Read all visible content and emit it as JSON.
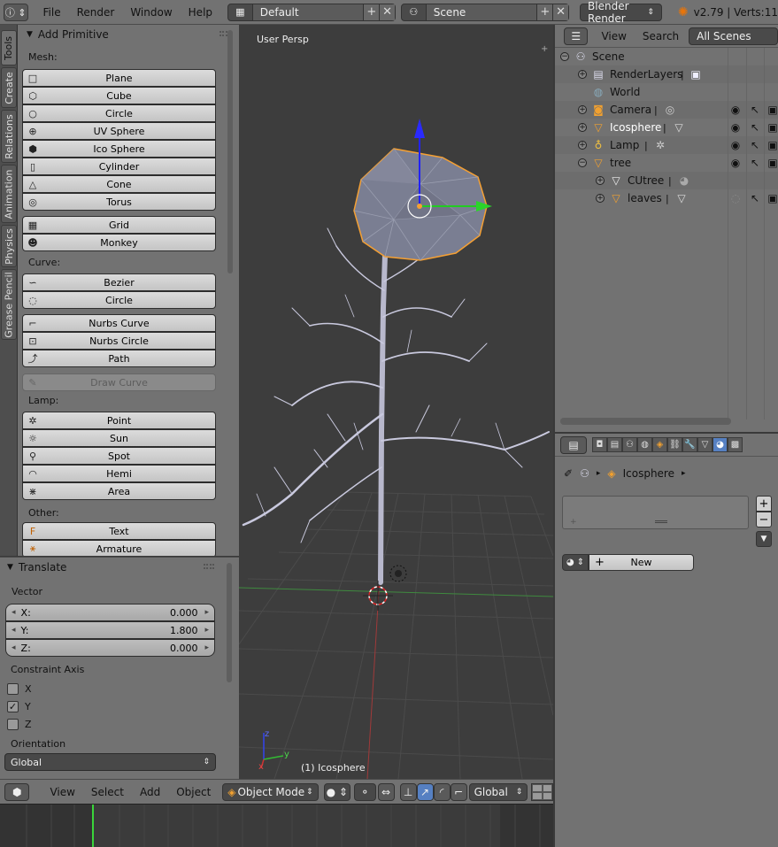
{
  "topbar": {
    "info_icon": "info-icon",
    "menus": [
      "File",
      "Render",
      "Window",
      "Help"
    ],
    "screen_layout": "Default",
    "scene": "Scene",
    "render_engine": "Blender Render",
    "version": "v2.79 | Verts:11"
  },
  "tool_tabs": [
    "Tools",
    "Create",
    "Relations",
    "Animation",
    "Physics",
    "Grease Pencil"
  ],
  "add_primitive": {
    "title": "Add Primitive",
    "mesh_label": "Mesh:",
    "mesh": [
      "Plane",
      "Cube",
      "Circle",
      "UV Sphere",
      "Ico Sphere",
      "Cylinder",
      "Cone",
      "Torus"
    ],
    "mesh_extra": [
      "Grid",
      "Monkey"
    ],
    "curve_label": "Curve:",
    "curve": [
      "Bezier",
      "Circle"
    ],
    "curve_nurbs": [
      "Nurbs Curve",
      "Nurbs Circle",
      "Path"
    ],
    "draw_curve": "Draw Curve",
    "lamp_label": "Lamp:",
    "lamp": [
      "Point",
      "Sun",
      "Spot",
      "Hemi",
      "Area"
    ],
    "other_label": "Other:",
    "other": [
      "Text",
      "Armature"
    ]
  },
  "translate": {
    "title": "Translate",
    "vector_label": "Vector",
    "x_label": "X:",
    "x": "0.000",
    "y_label": "Y:",
    "y": "1.800",
    "z_label": "Z:",
    "z": "0.000",
    "constraint_label": "Constraint Axis",
    "axis_x": "X",
    "axis_y": "Y",
    "axis_z": "Z",
    "axis_y_checked": true,
    "orientation_label": "Orientation",
    "orientation": "Global"
  },
  "viewport": {
    "view_name": "User Persp",
    "active_object": "(1) Icosphere",
    "axis_x": "x",
    "axis_y": "y",
    "axis_z": "z"
  },
  "viewport_header": {
    "menus": [
      "View",
      "Select",
      "Add",
      "Object"
    ],
    "mode": "Object Mode",
    "orientation": "Global"
  },
  "outliner": {
    "menus": [
      "View",
      "Search"
    ],
    "display_mode": "All Scenes",
    "items": [
      {
        "name": "Scene"
      },
      {
        "name": "RenderLayers"
      },
      {
        "name": "World"
      },
      {
        "name": "Camera"
      },
      {
        "name": "Icosphere"
      },
      {
        "name": "Lamp"
      },
      {
        "name": "tree"
      },
      {
        "name": "CUtree"
      },
      {
        "name": "leaves"
      }
    ]
  },
  "properties": {
    "breadcrumb_object": "Icosphere",
    "new_button": "New"
  },
  "colors": {
    "panel_bg": "#727272",
    "viewport_bg": "#3d3d3d",
    "selection_orange": "#f5a033",
    "active_blue": "#5680c2"
  }
}
